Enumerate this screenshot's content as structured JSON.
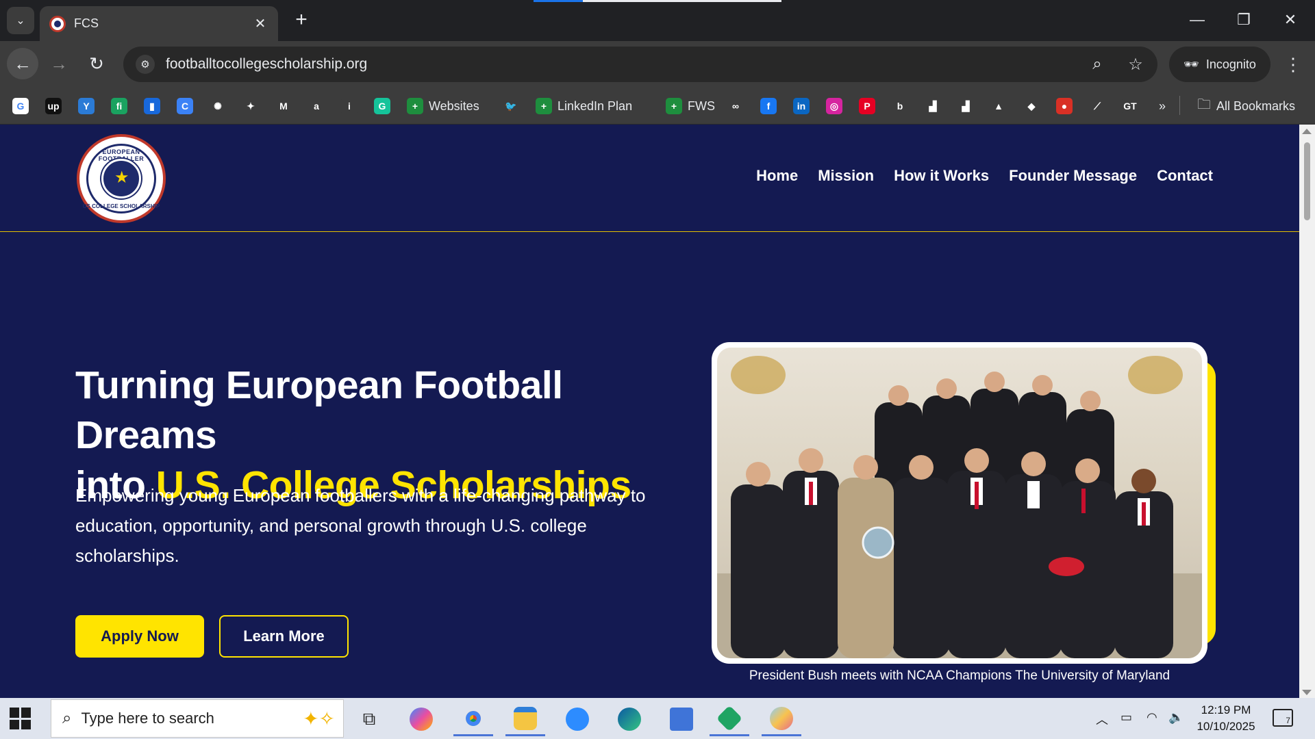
{
  "browser": {
    "tab_title": "FCS",
    "url": "footballtocollegescholarship.org",
    "incognito_label": "Incognito",
    "bookmarks": [
      {
        "icon": "google-icon",
        "color": "#ffffff",
        "glyph": "G",
        "label": ""
      },
      {
        "icon": "upwork-icon",
        "color": "#111111",
        "glyph": "up",
        "label": ""
      },
      {
        "icon": "yoast-icon",
        "color": "#2b7bd6",
        "glyph": "Y",
        "label": ""
      },
      {
        "icon": "fn-icon",
        "color": "#1aa260",
        "glyph": "fi",
        "label": ""
      },
      {
        "icon": "trello-icon",
        "color": "#1868db",
        "glyph": "▮",
        "label": ""
      },
      {
        "icon": "canva-icon",
        "color": "#3b82f6",
        "glyph": "C",
        "label": ""
      },
      {
        "icon": "chatgpt-icon",
        "color": "#3c3c3c",
        "glyph": "✺",
        "label": ""
      },
      {
        "icon": "gemini-icon",
        "color": "#3c3c3c",
        "glyph": "✦",
        "label": ""
      },
      {
        "icon": "gmail-icon",
        "color": "#3c3c3c",
        "glyph": "M",
        "label": ""
      },
      {
        "icon": "amazon-icon",
        "color": "#3c3c3c",
        "glyph": "a",
        "label": ""
      },
      {
        "icon": "info-icon",
        "color": "#3c3c3c",
        "glyph": "i",
        "label": ""
      },
      {
        "icon": "grammarly-icon",
        "color": "#15c39a",
        "glyph": "G",
        "label": ""
      },
      {
        "icon": "sheets-icon",
        "color": "#1e8e3e",
        "glyph": "+",
        "label": "Websites"
      },
      {
        "icon": "twitter-icon",
        "color": "#3c3c3c",
        "glyph": "🐦",
        "label": ""
      },
      {
        "icon": "sheets-icon",
        "color": "#1e8e3e",
        "glyph": "+",
        "label": "LinkedIn Plan"
      },
      {
        "icon": "sheets-icon",
        "color": "#1e8e3e",
        "glyph": "+",
        "label": "FWS"
      },
      {
        "icon": "meta-icon",
        "color": "#3c3c3c",
        "glyph": "∞",
        "label": ""
      },
      {
        "icon": "facebook-icon",
        "color": "#1877f2",
        "glyph": "f",
        "label": ""
      },
      {
        "icon": "linkedin-icon",
        "color": "#0a66c2",
        "glyph": "in",
        "label": ""
      },
      {
        "icon": "instagram-icon",
        "color": "#d6249f",
        "glyph": "◎",
        "label": ""
      },
      {
        "icon": "pinterest-icon",
        "color": "#e60023",
        "glyph": "P",
        "label": ""
      },
      {
        "icon": "bing-icon",
        "color": "#3c3c3c",
        "glyph": "b",
        "label": ""
      },
      {
        "icon": "analytics-icon",
        "color": "#3c3c3c",
        "glyph": "▟",
        "label": ""
      },
      {
        "icon": "analytics-orange-icon",
        "color": "#3c3c3c",
        "glyph": "▟",
        "label": ""
      },
      {
        "icon": "drive-icon",
        "color": "#3c3c3c",
        "glyph": "▲",
        "label": ""
      },
      {
        "icon": "diamond-icon",
        "color": "#3c3c3c",
        "glyph": "◆",
        "label": ""
      },
      {
        "icon": "red-app-icon",
        "color": "#d93025",
        "glyph": "●",
        "label": ""
      },
      {
        "icon": "ads-icon",
        "color": "#3c3c3c",
        "glyph": "⟋",
        "label": ""
      },
      {
        "icon": "gtmetrix-icon",
        "color": "#3c3c3c",
        "glyph": "GT",
        "label": ""
      }
    ],
    "all_bookmarks_label": "All Bookmarks"
  },
  "site": {
    "logo_text_top": "EUROPEAN FOOTBALLER",
    "logo_text_bottom": "US COLLEGE SCHOLARSHIP",
    "nav": [
      "Home",
      "Mission",
      "How it Works",
      "Founder Message",
      "Contact"
    ],
    "hero": {
      "title_line1": "Turning European Football Dreams",
      "title_line2_plain": "into ",
      "title_line2_highlight": "U.S. College Scholarships",
      "subtitle": "Empowering young European footballers with a life-changing pathway to education, opportunity, and personal growth through U.S. college scholarships.",
      "apply_label": "Apply Now",
      "learn_label": "Learn More"
    },
    "photo_caption": "President Bush meets with NCAA Champions The University of Maryland",
    "colors": {
      "background": "#141a52",
      "accent": "#ffe400",
      "text": "#ffffff"
    }
  },
  "taskbar": {
    "search_placeholder": "Type here to search",
    "time": "12:19 PM",
    "date": "10/10/2025",
    "notifications": "7"
  }
}
